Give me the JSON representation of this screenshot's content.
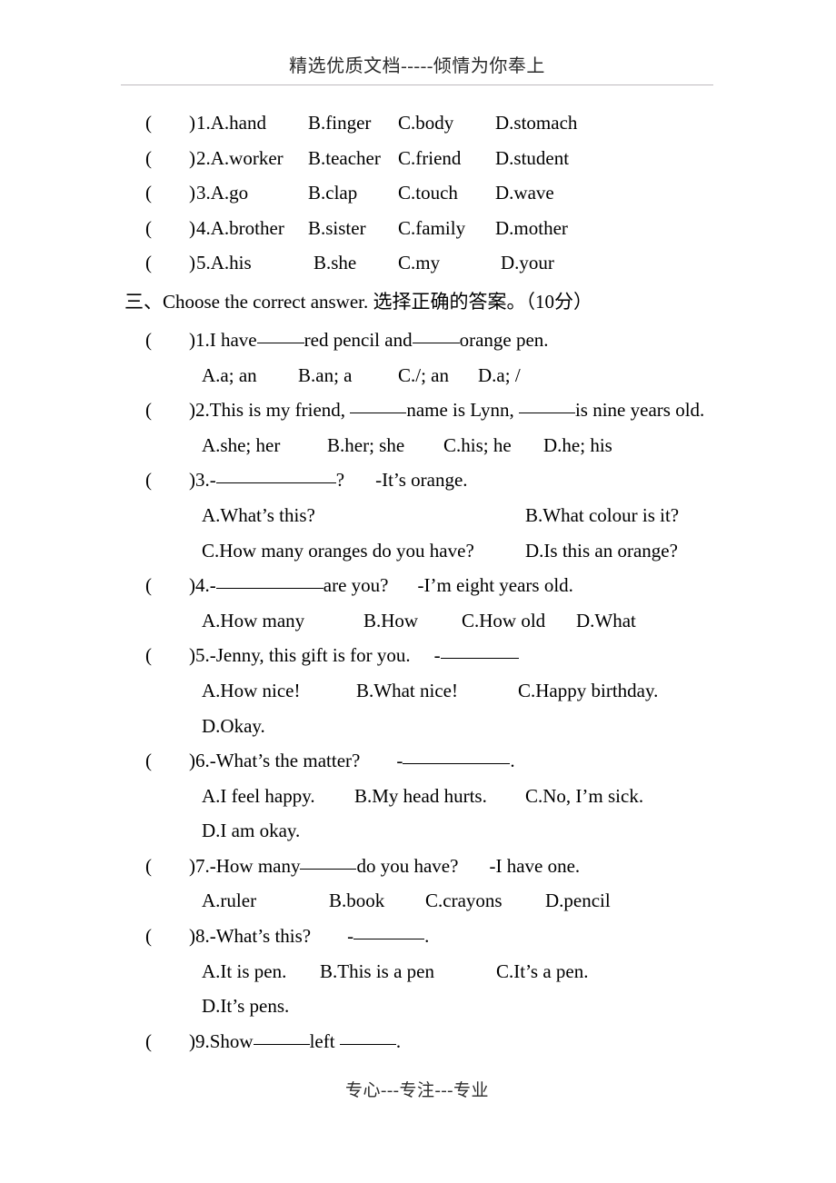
{
  "header": {
    "text": "精选优质文档-----倾情为你奉上"
  },
  "footer": {
    "text": "专心---专注---专业"
  },
  "marks": {
    "open_paren": "(",
    "close_paren": ")"
  },
  "vocab_section": {
    "items": [
      {
        "num": "1.",
        "a": "A.hand",
        "b": "B.finger",
        "c": "C.body",
        "d": "D.stomach"
      },
      {
        "num": "2.",
        "a": "A.worker",
        "b": "B.teacher",
        "c": "C.friend",
        "d": "D.student"
      },
      {
        "num": "3.",
        "a": "A.go",
        "b": "B.clap",
        "c": "C.touch",
        "d": "D.wave"
      },
      {
        "num": "4.",
        "a": "A.brother",
        "b": "B.sister",
        "c": "C.family",
        "d": "D.mother"
      },
      {
        "num": "5.",
        "a": "A.his",
        "b": "B.she",
        "c": "C.my",
        "d": "D.your"
      }
    ]
  },
  "section_three": {
    "heading": "三、Choose the correct answer. 选择正确的答案。（10分）",
    "questions": {
      "q1": {
        "stem_a": ")1.I have",
        "stem_b": "red pencil and",
        "stem_c": "orange pen.",
        "opt_a": "A.a; an",
        "opt_b": "B.an; a",
        "opt_c": "C./; an",
        "opt_d": "D.a; /"
      },
      "q2": {
        "stem_a": ")2.This is my friend, ",
        "stem_b": "name is Lynn, ",
        "stem_c": "is nine years old.",
        "opt_a": "A.she; her",
        "opt_b": "B.her; she",
        "opt_c": "C.his; he",
        "opt_d": "D.he; his"
      },
      "q3": {
        "stem_a": ")3.-",
        "stem_b": "?",
        "stem_c": "-It’s orange.",
        "opt_a": "A.What’s this?",
        "opt_b": "B.What colour is it?",
        "opt_c": "C.How many oranges do you have?",
        "opt_d": "D.Is this an orange?"
      },
      "q4": {
        "stem_a": ")4.-",
        "stem_b": "are you?",
        "stem_c": "-I’m eight years old.",
        "opt_a": "A.How many",
        "opt_b": "B.How",
        "opt_c": "C.How old",
        "opt_d": "D.What"
      },
      "q5": {
        "stem_a": ")5.-Jenny, this gift is for you.",
        "stem_b": "-",
        "opt_a": "A.How nice!",
        "opt_b": "B.What nice!",
        "opt_c": "C.Happy birthday.",
        "opt_d": "D.Okay."
      },
      "q6": {
        "stem_a": ")6.-What’s the matter?",
        "stem_b": "-",
        "stem_c": ".",
        "opt_a": "A.I feel happy.",
        "opt_b": "B.My head hurts.",
        "opt_c": "C.No, I’m sick.",
        "opt_d": "D.I am okay."
      },
      "q7": {
        "stem_a": ")7.-How many",
        "stem_b": "do you have?",
        "stem_c": "-I have one.",
        "opt_a": "A.ruler",
        "opt_b": "B.book",
        "opt_c": "C.crayons",
        "opt_d": "D.pencil"
      },
      "q8": {
        "stem_a": ")8.-What’s this?",
        "stem_b": "-",
        "stem_c": ".",
        "opt_a": "A.It is pen.",
        "opt_b": "B.This is a pen",
        "opt_c": "C.It’s a pen.",
        "opt_d": "D.It’s pens."
      },
      "q9": {
        "stem_a": ")9.Show",
        "stem_b": "left ",
        "stem_c": "."
      }
    }
  }
}
